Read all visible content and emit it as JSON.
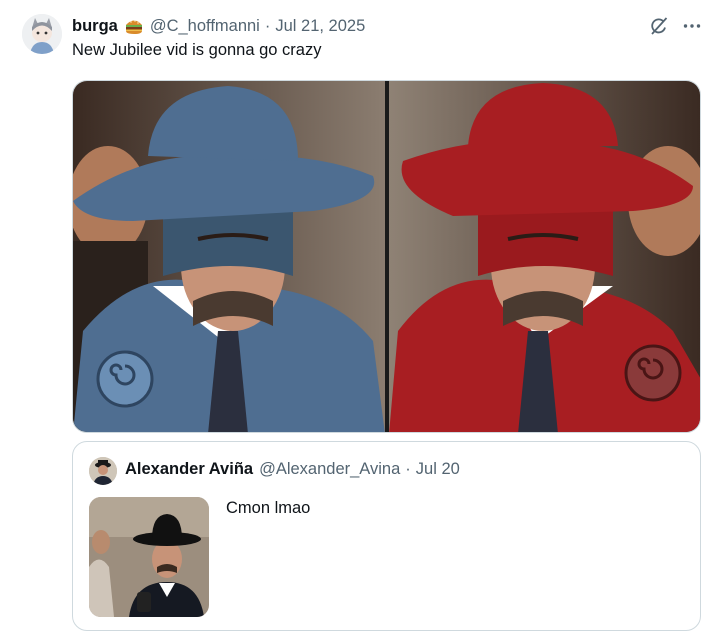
{
  "tweet": {
    "author_name": "burga",
    "author_emoji": "hamburger",
    "handle": "@C_hoffmanni",
    "separator": "·",
    "date": "Jul 21, 2025",
    "text": "New Jubilee vid is gonna go crazy"
  },
  "icons": {
    "grok": "grok-icon",
    "more": "more-icon"
  },
  "media": {
    "left_panel_color": "#4f6e91",
    "right_panel_color": "#a81e22"
  },
  "quote": {
    "author_name": "Alexander Aviña",
    "handle": "@Alexander_Avina",
    "separator": "·",
    "date": "Jul 20",
    "text": "Cmon lmao"
  }
}
